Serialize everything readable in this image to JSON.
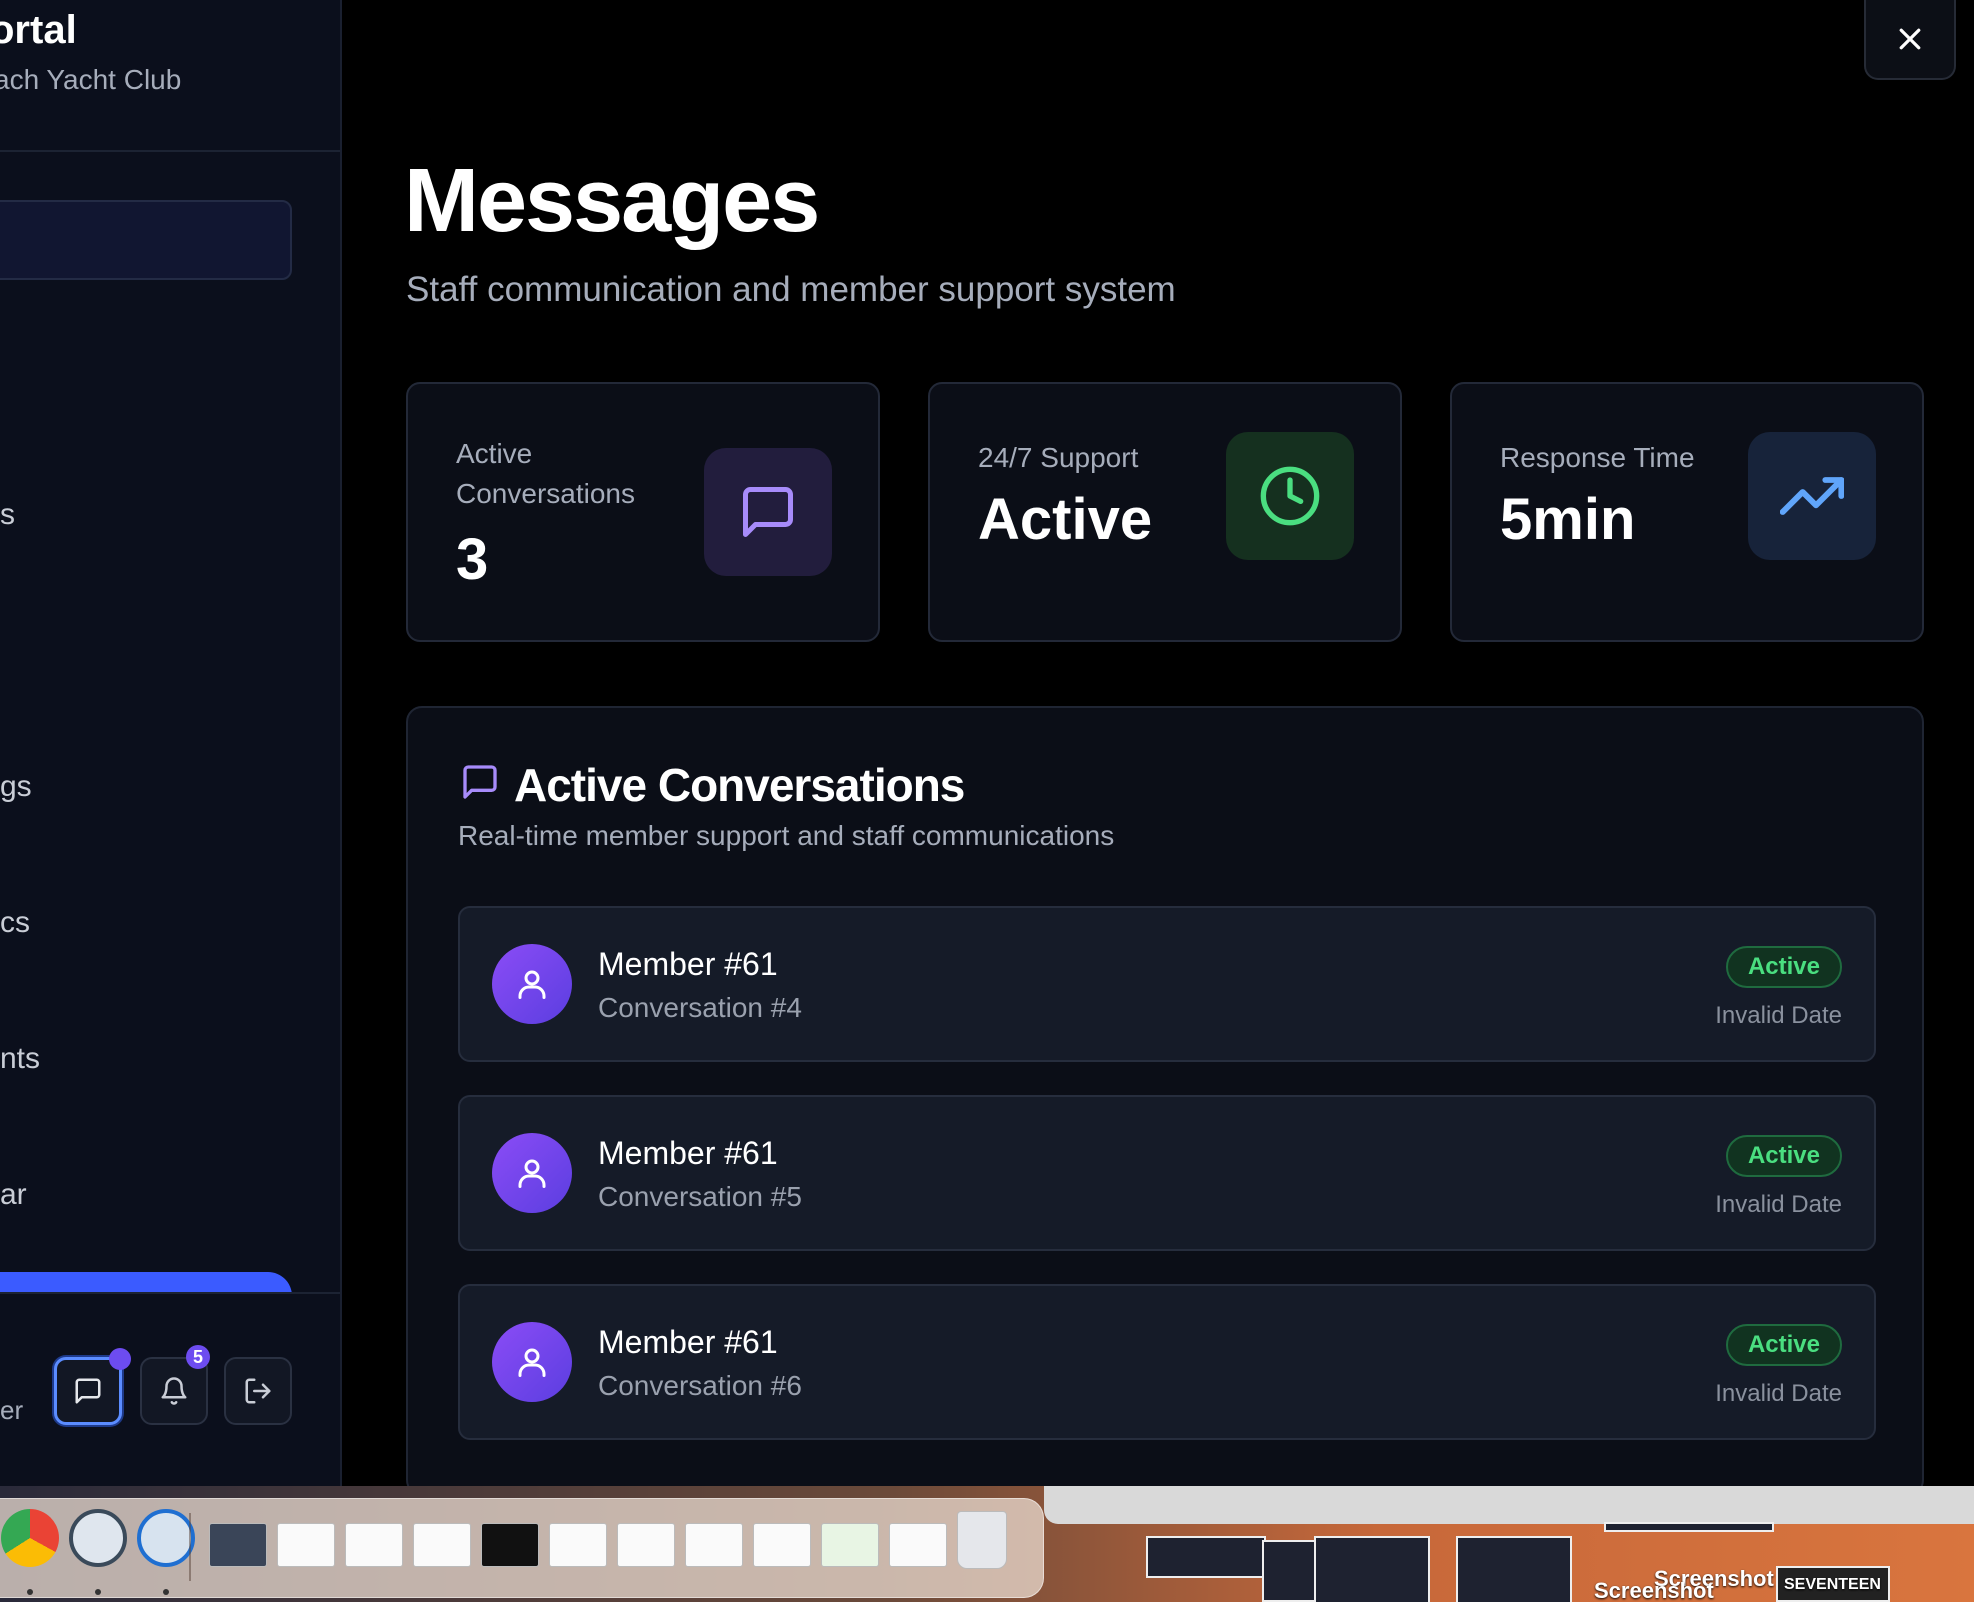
{
  "sidebar": {
    "title": "ortal",
    "subtitle": "ach Yacht Club",
    "nav_fragments": [
      "s",
      "gs",
      "cs",
      "nts",
      "ar"
    ],
    "footer_text": "er",
    "notification_count": "5"
  },
  "main": {
    "title": "Messages",
    "subtitle": "Staff communication and member support system"
  },
  "stats": [
    {
      "label": "Active Conversations",
      "value": "3",
      "icon": "message-square-icon",
      "color": "#a78bfa"
    },
    {
      "label": "24/7 Support",
      "value": "Active",
      "icon": "clock-icon",
      "color": "#4ade80"
    },
    {
      "label": "Response Time",
      "value": "5min",
      "icon": "trending-up-icon",
      "color": "#60a5fa"
    }
  ],
  "panel": {
    "title": "Active Conversations",
    "subtitle": "Real-time member support and staff communications"
  },
  "conversations": [
    {
      "name": "Member #61",
      "subtitle": "Conversation #4",
      "status": "Active",
      "date": "Invalid Date"
    },
    {
      "name": "Member #61",
      "subtitle": "Conversation #5",
      "status": "Active",
      "date": "Invalid Date"
    },
    {
      "name": "Member #61",
      "subtitle": "Conversation #6",
      "status": "Active",
      "date": "Invalid Date"
    }
  ],
  "desktop": {
    "screenshot_label_1": "Screenshot",
    "screenshot_label_2": "Screenshot",
    "seventeen_label": "SEVENTEEN"
  },
  "colors": {
    "accent": "#3b5bff",
    "purple": "#8b4cf6",
    "success": "#4ade80"
  }
}
